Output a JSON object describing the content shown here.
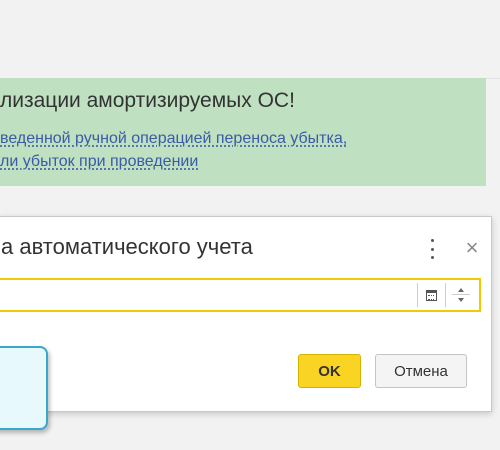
{
  "banner": {
    "title": "лизации амортизируемых ОС!",
    "link_line1": "веденной ручной операцией переноса убытка,",
    "link_line2": "ли убыток при проведении"
  },
  "dialog": {
    "title": "а автоматического учета",
    "date_value": "",
    "ok_label": "OK",
    "cancel_label": "Отмена",
    "close_glyph": "×"
  },
  "colors": {
    "banner_bg": "#bfe0c1",
    "link": "#3a5ba6",
    "ok_button": "#f9d423",
    "focus_border": "#f5c900",
    "callout_border": "#3aa9c9"
  },
  "icons": [
    "more-vert-icon",
    "close-icon",
    "calendar-icon",
    "spin-up-icon",
    "spin-down-icon"
  ]
}
